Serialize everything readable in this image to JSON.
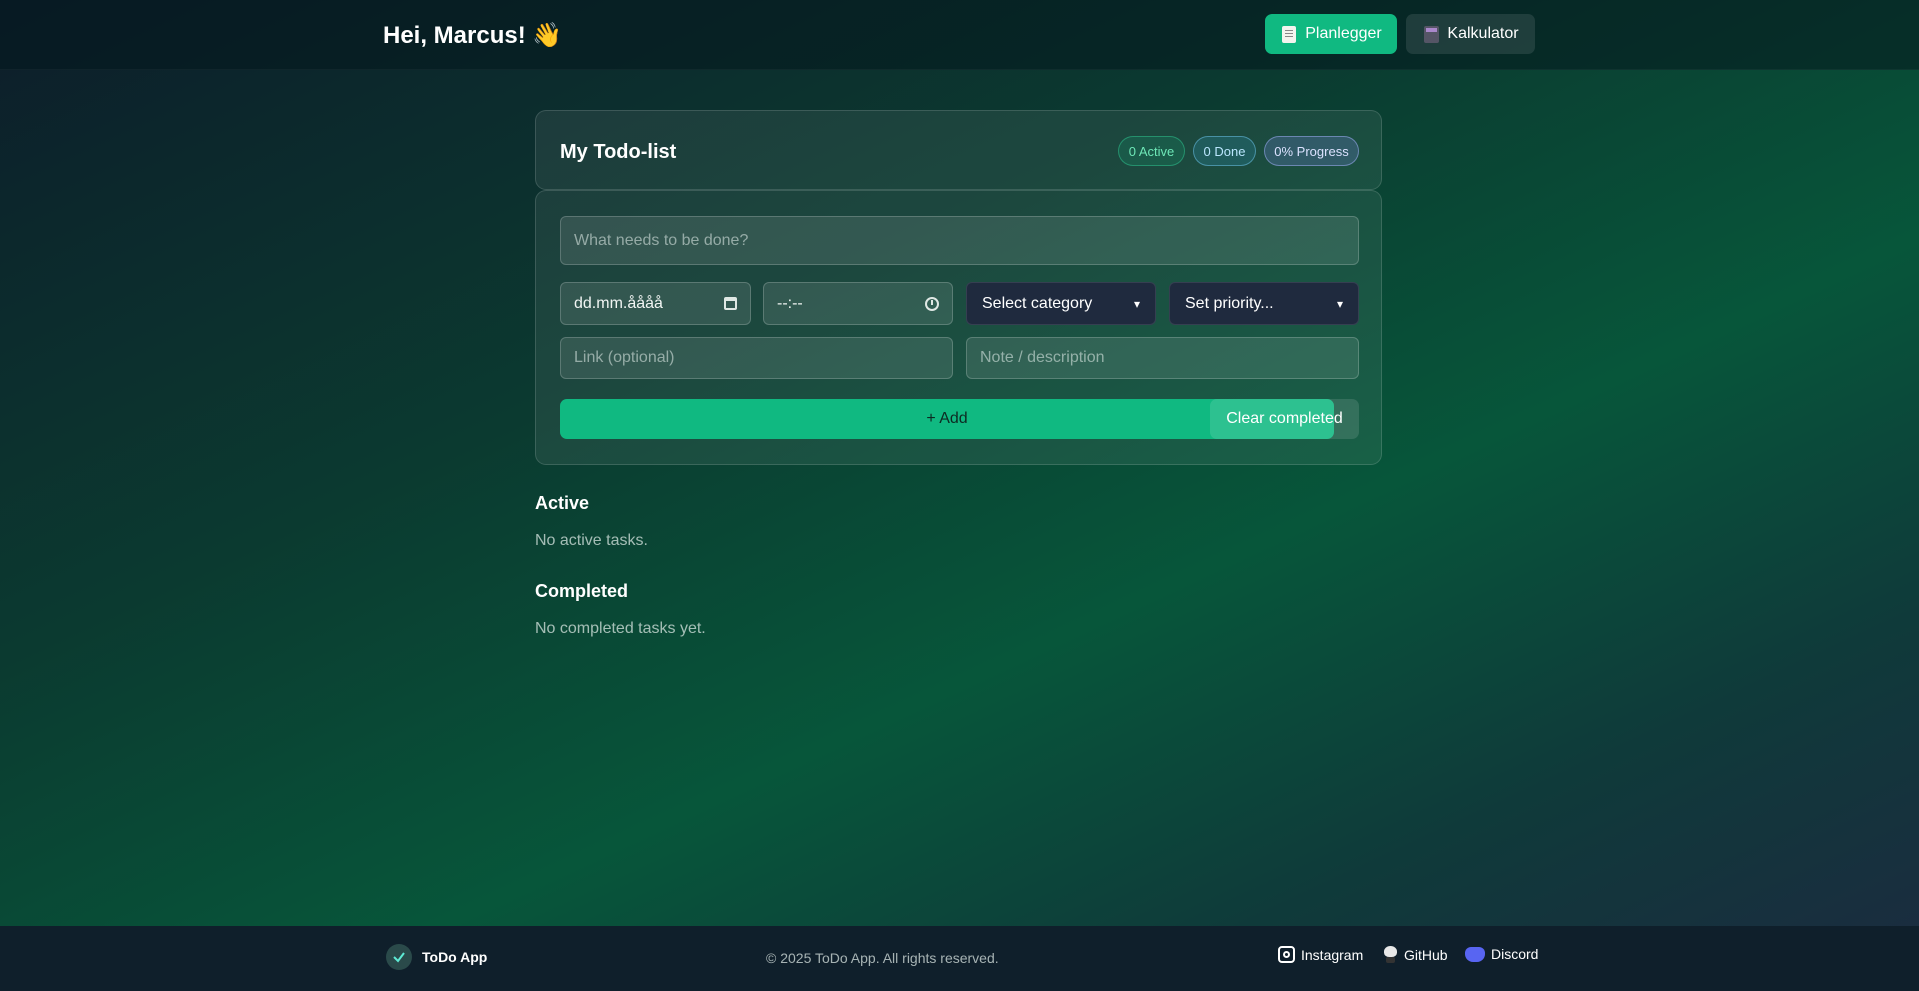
{
  "header": {
    "greeting": "Hei, Marcus! 👋",
    "nav": {
      "planner_label": "Planlegger",
      "calculator_label": "Kalkulator"
    }
  },
  "todo": {
    "title": "My Todo-list",
    "badges": {
      "active": "0 Active",
      "done": "0 Done",
      "progress": "0% Progress"
    },
    "form": {
      "task_placeholder": "What needs to be done?",
      "date_value": "dd.mm.åååå",
      "time_value": "--:--",
      "category_value": "Select category",
      "priority_value": "Set priority...",
      "link_placeholder": "Link (optional)",
      "note_placeholder": "Note / description",
      "add_label": "+ Add",
      "clear_label": "Clear completed"
    }
  },
  "sections": {
    "active": {
      "title": "Active",
      "empty": "No active tasks."
    },
    "completed": {
      "title": "Completed",
      "empty": "No completed tasks yet."
    }
  },
  "footer": {
    "brand": "ToDo App",
    "logo_text": "ToDo",
    "copyright": "© 2025 ToDo App. All rights reserved.",
    "links": {
      "instagram": "Instagram",
      "github": "GitHub",
      "discord": "Discord"
    }
  },
  "colors": {
    "accent": "#10b981",
    "select_bg": "#1f2a3e",
    "footer_bg": "#0f1f2b"
  },
  "icons": {
    "planner": "memo-icon",
    "calculator": "calculator-icon",
    "date": "calendar-icon",
    "time": "clock-icon",
    "logo": "check-logo-icon",
    "instagram": "instagram-icon",
    "github": "github-icon",
    "discord": "discord-icon"
  }
}
